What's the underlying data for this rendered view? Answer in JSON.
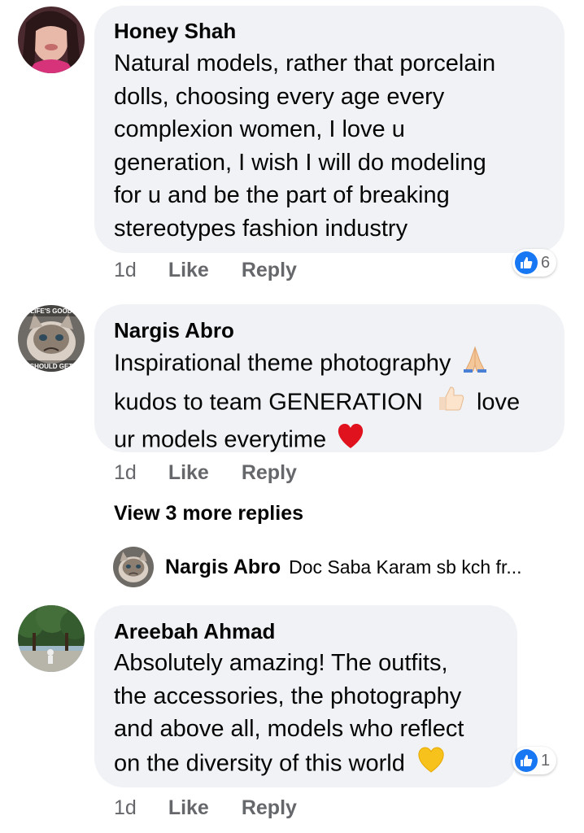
{
  "comments": [
    {
      "author": "Honey Shah",
      "lines": [
        "Natural models, rather that porcelain",
        "dolls, choosing every age every",
        "complexion women, I love u",
        "generation, I wish I will do  modeling",
        "for u and be the part of breaking",
        "stereotypes fashion industry"
      ],
      "time": "1d",
      "like_label": "Like",
      "reply_label": "Reply",
      "reaction_count": "6"
    },
    {
      "author": "Nargis Abro",
      "line1": "Inspirational theme photography",
      "line2a": "kudos to team GENERATION",
      "line2b": "love",
      "line3": "ur models everytime",
      "avatar_top_text": "LIFE'S GOOD",
      "avatar_bottom_text": "SHOULD GET",
      "time": "1d",
      "like_label": "Like",
      "reply_label": "Reply",
      "view_more": "View 3 more replies",
      "reply_preview": {
        "author": "Nargis Abro",
        "text": "Doc Saba Karam sb kch fr..."
      }
    },
    {
      "author": "Areebah Ahmad",
      "lines": [
        "Absolutely amazing! The outfits,",
        "the accessories, the photography",
        "and above all, models who reflect"
      ],
      "last_line": "on the diversity of this world",
      "time": "1d",
      "like_label": "Like",
      "reply_label": "Reply",
      "reaction_count": "1"
    }
  ],
  "colors": {
    "bubble": "#f0f2f5",
    "secondary_text": "#65676b",
    "like_blue": "#1877f2"
  }
}
